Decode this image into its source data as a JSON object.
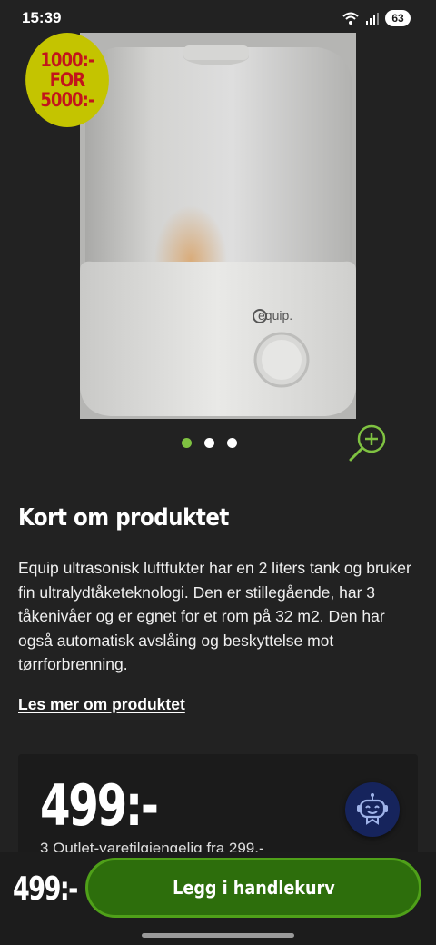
{
  "status_bar": {
    "time": "15:39",
    "battery": "63",
    "icons": [
      "wifi-icon",
      "signal-icon"
    ]
  },
  "product": {
    "image_alt": "Equip ultrasonisk luftfukter",
    "brand_logo": "equip.",
    "promo_badge": {
      "line1": "1000:-",
      "line2": "FOR",
      "line3": "5000:-",
      "color_bg": "#c4c400",
      "color_text": "#c2151b"
    },
    "carousel": {
      "count": 3,
      "active_index": 0
    }
  },
  "about": {
    "title": "Kort om produktet",
    "description": "Equip ultrasonisk luftfukter har en 2 liters tank og bruker fin ultralydtåketeknologi. Den er stillegående, har 3 tåkenivåer og er egnet for et rom på 32 m2. Den har også automatisk avslåing og beskyttelse mot tørrforbrenning.",
    "read_more": "Les mer om produktet"
  },
  "price_card": {
    "price": "499:-",
    "sub_text": "3 Outlet-varetilgjengelig fra 299,-"
  },
  "bottom_bar": {
    "price": "499:-",
    "cta_label": "Legg i handlekurv"
  },
  "colors": {
    "accent_green": "#7fc241",
    "cta_bg": "#2d6e0c",
    "background": "#222222"
  }
}
